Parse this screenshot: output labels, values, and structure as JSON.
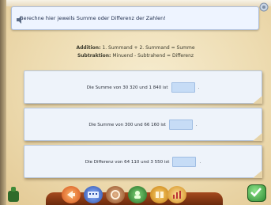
{
  "prompt": {
    "text": "Berechne hier jeweils Summe oder Differenz der Zahlen!"
  },
  "rules": {
    "addition_label": "Addition:",
    "addition_text": "1. Summand + 2. Summand = Summe",
    "subtraction_label": "Subtraktion:",
    "subtraction_text": "Minuend - Subtrahend = Differenz"
  },
  "tasks": [
    {
      "prefix": "Die Summe von 30 320 und 1 840 ist",
      "suffix": ".",
      "answer": ""
    },
    {
      "prefix": "Die Summe von 300 und 66 160 ist",
      "suffix": ".",
      "answer": ""
    },
    {
      "prefix": "Die Differenz von 64 110 und 3 550 ist",
      "suffix": ".",
      "answer": ""
    }
  ],
  "toolbar": {
    "buttons": [
      {
        "icon": "arrow-icon"
      },
      {
        "icon": "keyboard-icon"
      },
      {
        "icon": "help-icon"
      },
      {
        "icon": "character-icon"
      },
      {
        "icon": "book-icon"
      },
      {
        "icon": "statistics-icon"
      }
    ]
  },
  "colors": {
    "accent_blue": "#c6dcf6",
    "wood": "#8a3612",
    "check_green": "#3aa33e"
  }
}
